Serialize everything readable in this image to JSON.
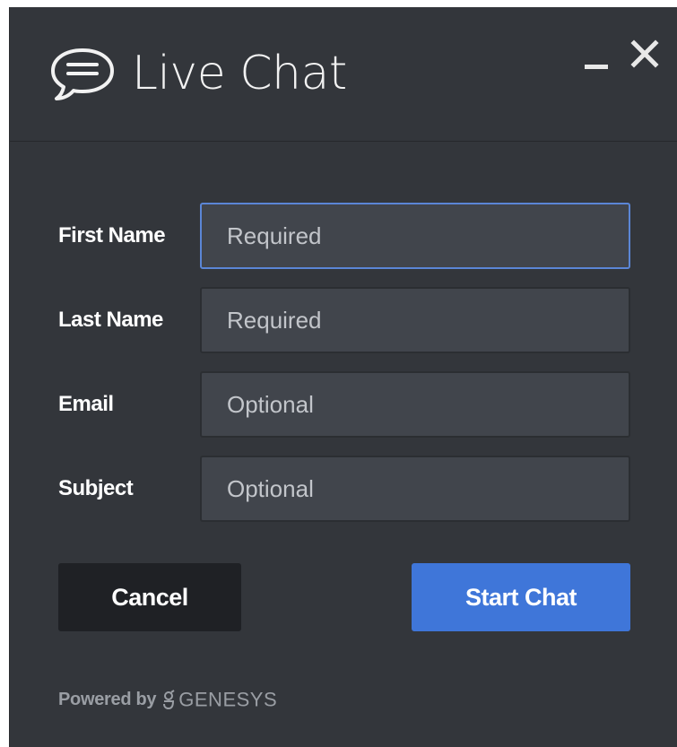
{
  "header": {
    "icon": "chat-bubble-icon",
    "title": "Live Chat",
    "minimize_icon": "minimize-icon",
    "close_icon": "close-icon"
  },
  "form": {
    "fields": [
      {
        "label": "First Name",
        "placeholder": "Required",
        "value": "",
        "focused": true
      },
      {
        "label": "Last Name",
        "placeholder": "Required",
        "value": ""
      },
      {
        "label": "Email",
        "placeholder": "Optional",
        "value": ""
      },
      {
        "label": "Subject",
        "placeholder": "Optional",
        "value": ""
      }
    ]
  },
  "buttons": {
    "cancel_label": "Cancel",
    "start_label": "Start Chat"
  },
  "footer": {
    "powered_by": "Powered by",
    "brand_icon": "genesys-logo-icon",
    "brand": "GENESYS"
  },
  "colors": {
    "panel_bg": "#33363b",
    "input_bg": "#41454c",
    "focus_border": "#5b86d6",
    "primary_button": "#3f76d9",
    "cancel_button": "#1f2125",
    "footer_text": "#9a9ea4"
  }
}
